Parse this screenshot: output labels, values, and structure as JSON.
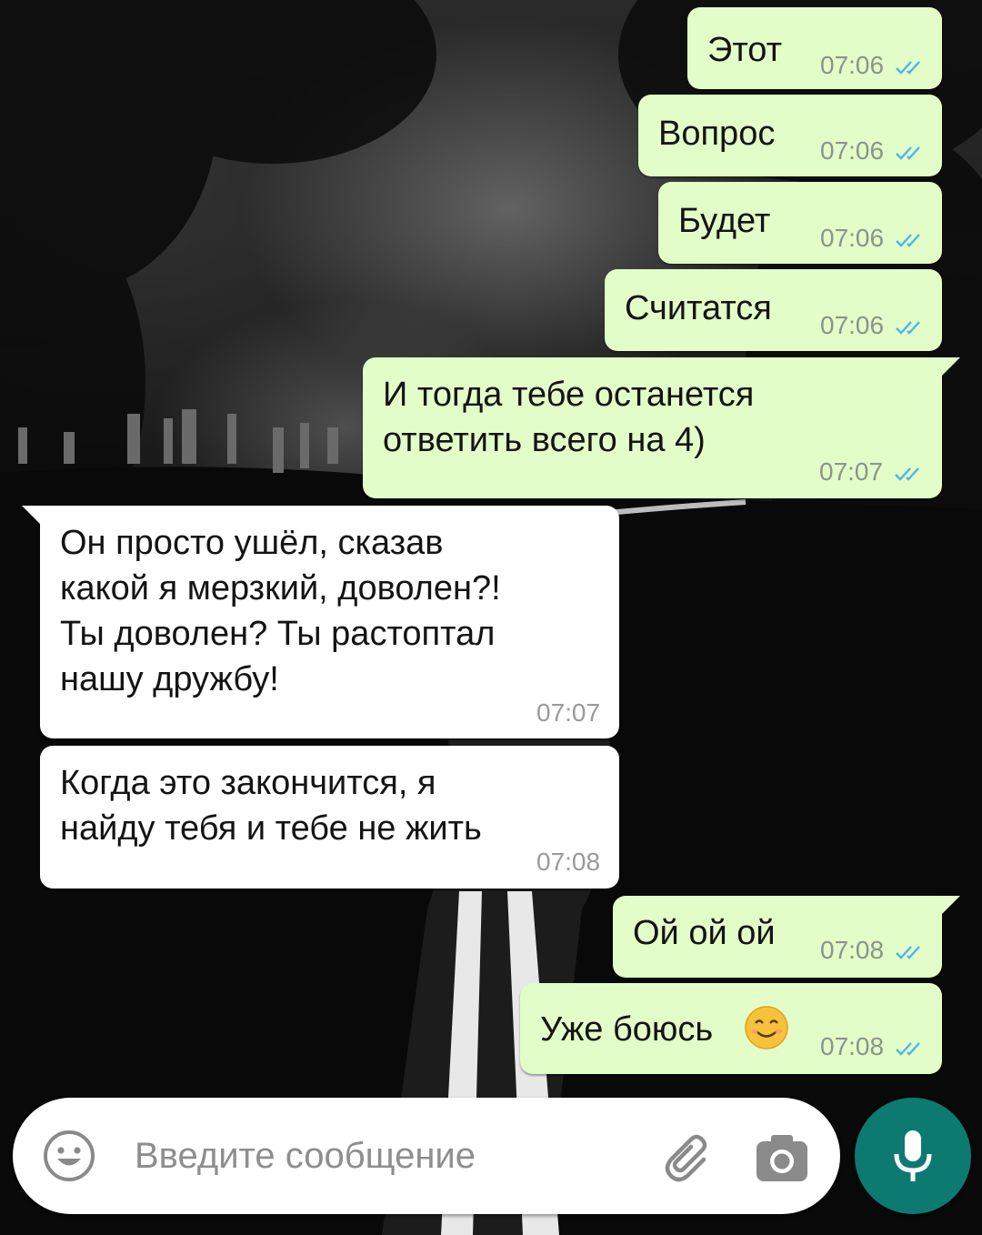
{
  "colors": {
    "outgoing_bubble": "#e2fdc8",
    "incoming_bubble": "#ffffff",
    "read_ticks": "#4fb5e6",
    "mic_button": "#0c7a71"
  },
  "messages": [
    {
      "direction": "out",
      "text": "Этот",
      "time": "07:06",
      "status": "read"
    },
    {
      "direction": "out",
      "text": "Вопрос",
      "time": "07:06",
      "status": "read"
    },
    {
      "direction": "out",
      "text": "Будет",
      "time": "07:06",
      "status": "read"
    },
    {
      "direction": "out",
      "text": "Считатся",
      "time": "07:06",
      "status": "read"
    },
    {
      "direction": "out",
      "text": "И тогда тебе останется\nответить всего на 4)",
      "time": "07:07",
      "status": "read"
    },
    {
      "direction": "in",
      "text": "Он просто ушёл, сказав\nкакой я мерзкий, доволен?!\nТы доволен? Ты растоптал\nнашу дружбу!",
      "time": "07:07"
    },
    {
      "direction": "in",
      "text": "Когда это закончится, я\nнайду тебя и тебе не жить",
      "time": "07:08"
    },
    {
      "direction": "out",
      "text": "Ой ой ой",
      "time": "07:08",
      "status": "read"
    },
    {
      "direction": "out",
      "text": "Уже боюсь",
      "emoji": "smiling-face-emoji",
      "time": "07:08",
      "status": "read"
    }
  ],
  "input": {
    "placeholder": "Введите сообщение",
    "emoji_icon": "emoji-smile-icon",
    "attach_icon": "paperclip-icon",
    "camera_icon": "camera-icon",
    "mic_icon": "microphone-icon"
  }
}
